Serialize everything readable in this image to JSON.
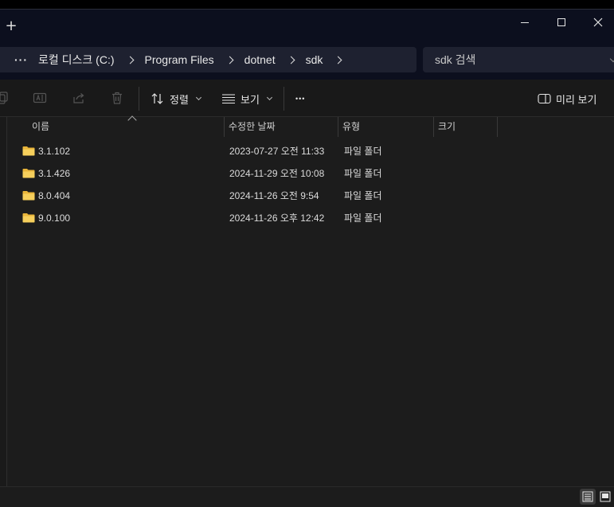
{
  "titlebar": {
    "new_tab": "+"
  },
  "address": {
    "more": "···",
    "crumbs": [
      "로컬 디스크 (C:)",
      "Program Files",
      "dotnet",
      "sdk"
    ]
  },
  "search": {
    "placeholder": "sdk 검색"
  },
  "toolbar": {
    "sort_label": "정렬",
    "view_label": "보기",
    "more_label": "•••",
    "preview_label": "미리 보기"
  },
  "columns": {
    "name": "이름",
    "modified": "수정한 날짜",
    "type": "유형",
    "size": "크기"
  },
  "files": [
    {
      "name": "3.1.102",
      "modified": "2023-07-27 오전 11:33",
      "type": "파일 폴더",
      "size": ""
    },
    {
      "name": "3.1.426",
      "modified": "2024-11-29 오전 10:08",
      "type": "파일 폴더",
      "size": ""
    },
    {
      "name": "8.0.404",
      "modified": "2024-11-26 오전 9:54",
      "type": "파일 폴더",
      "size": ""
    },
    {
      "name": "9.0.100",
      "modified": "2024-11-26 오후 12:42",
      "type": "파일 폴더",
      "size": ""
    }
  ],
  "colors": {
    "folder": "#f4c44a",
    "titlebar_bg": "#0c0f1e",
    "content_bg": "#1c1c1c"
  },
  "icons": [
    "plus-icon",
    "minimize-icon",
    "maximize-icon",
    "close-icon",
    "copy-icon",
    "rename-icon",
    "share-icon",
    "delete-icon",
    "sort-icon",
    "view-icon",
    "more-icon",
    "preview-pane-icon",
    "folder-icon",
    "details-view-icon",
    "tiles-view-icon"
  ]
}
